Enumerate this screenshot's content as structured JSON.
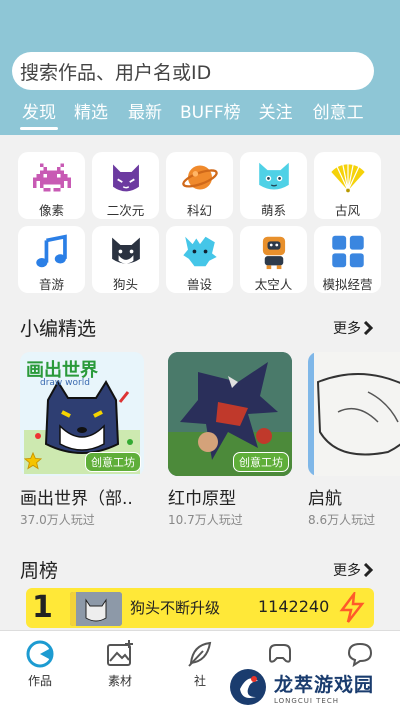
{
  "search": {
    "placeholder": "搜索作品、用户名或ID"
  },
  "tabs": [
    {
      "label": "发现",
      "active": true
    },
    {
      "label": "精选"
    },
    {
      "label": "最新"
    },
    {
      "label": "BUFF榜"
    },
    {
      "label": "关注"
    },
    {
      "label": "创意工"
    }
  ],
  "categories": [
    {
      "label": "像素",
      "icon": "space-invader-icon"
    },
    {
      "label": "二次元",
      "icon": "anime-cat-icon"
    },
    {
      "label": "科幻",
      "icon": "planet-icon"
    },
    {
      "label": "萌系",
      "icon": "cute-cat-icon"
    },
    {
      "label": "古风",
      "icon": "folding-fan-icon"
    },
    {
      "label": "音游",
      "icon": "music-note-icon"
    },
    {
      "label": "狗头",
      "icon": "dog-head-icon"
    },
    {
      "label": "兽设",
      "icon": "beast-icon"
    },
    {
      "label": "太空人",
      "icon": "astronaut-icon"
    },
    {
      "label": "模拟经营",
      "icon": "grid-blocks-icon"
    }
  ],
  "picks": {
    "title": "小编精选",
    "more": "更多",
    "items": [
      {
        "title": "画出世界（部..",
        "plays": "37.0万人玩过",
        "badge": "创意工坊",
        "thumb_text": "画出世界",
        "thumb_sub": "draw world"
      },
      {
        "title": "红巾原型",
        "plays": "10.7万人玩过",
        "badge": "创意工坊"
      },
      {
        "title": "启航",
        "plays": "8.6万人玩过"
      }
    ]
  },
  "weekly": {
    "title": "周榜",
    "more": "更多",
    "rank": "1",
    "name": "狗头不断升级",
    "score": "1142240"
  },
  "nav": [
    {
      "label": "作品",
      "icon": "works-icon",
      "active": true
    },
    {
      "label": "素材",
      "icon": "image-add-icon"
    },
    {
      "label": "社",
      "icon": "feather-icon"
    },
    {
      "label": "",
      "icon": "game-controller-icon"
    },
    {
      "label": "",
      "icon": "chat-bubble-icon"
    }
  ],
  "watermark": {
    "main": "龙萃游戏园",
    "sub": "LONGCUI TECH"
  },
  "colors": {
    "header": "#8ec6d6",
    "accent": "#1d9bd1",
    "weekly": "#ffe838",
    "badge": "#5fae39"
  }
}
